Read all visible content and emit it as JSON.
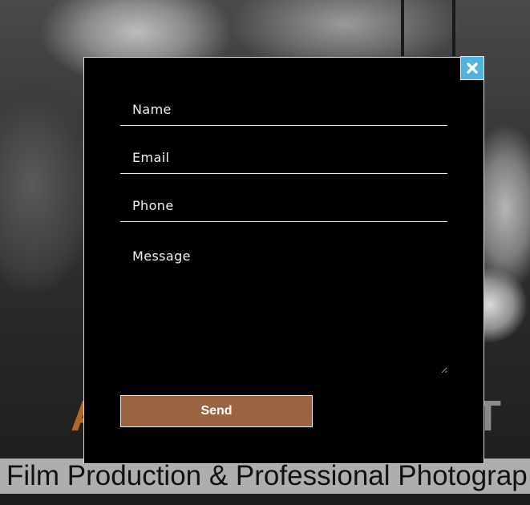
{
  "background": {
    "headline_visible_start": "A",
    "headline_visible_end": "T",
    "tagline": "Film Production & Professional Photograp"
  },
  "modal": {
    "close_icon": "close-icon",
    "fields": {
      "name_placeholder": "Name",
      "email_placeholder": "Email",
      "phone_placeholder": "Phone",
      "message_placeholder": "Message"
    },
    "send_label": "Send"
  },
  "colors": {
    "close_button": "#4fb3dc",
    "send_button": "#9a6442",
    "headline_accent": "#b5652c",
    "modal_background": "#000000"
  }
}
